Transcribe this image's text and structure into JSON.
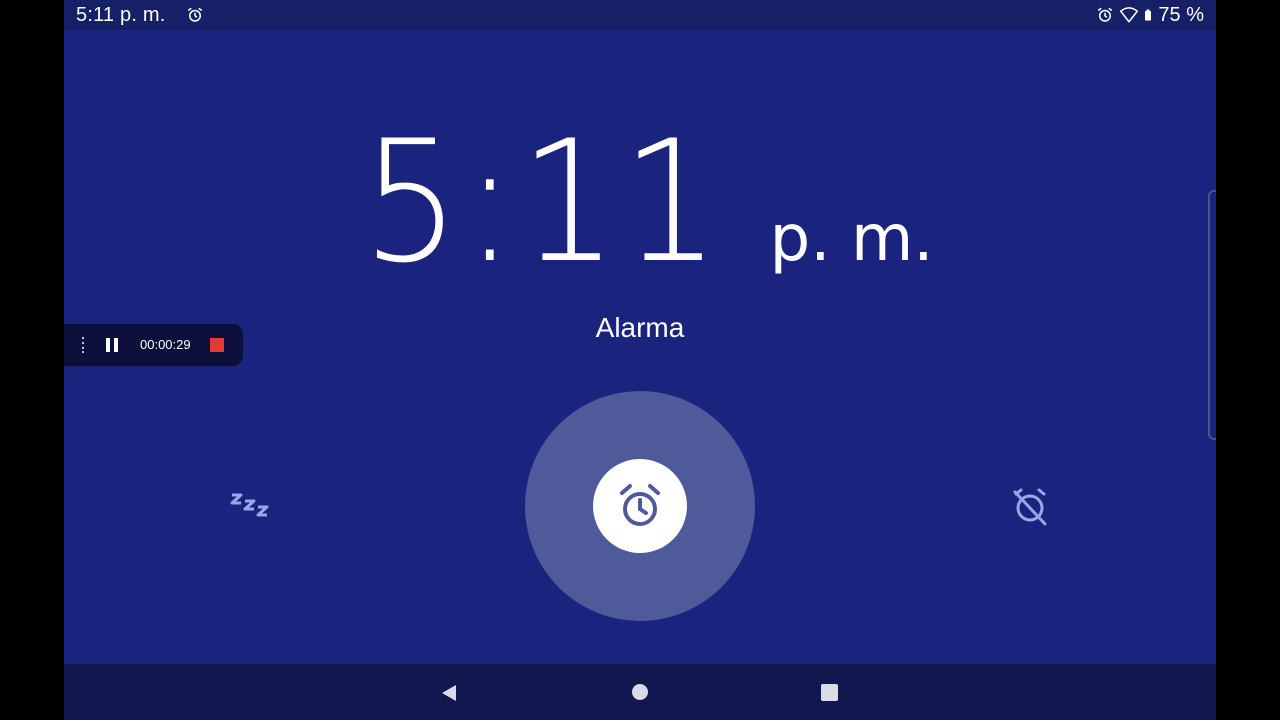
{
  "status_bar": {
    "time": "5:11 p. m.",
    "left_icons": [
      "alarm-icon"
    ],
    "right_icons": [
      "alarm-icon",
      "wifi-icon",
      "battery-icon"
    ],
    "battery_percent": "75 %"
  },
  "clock": {
    "time": "5:11",
    "ampm": "p. m."
  },
  "alarm": {
    "label": "Alarma",
    "actions": {
      "snooze_icon": "snooze-zzz-icon",
      "center_icon": "alarm-clock-icon",
      "dismiss_icon": "alarm-off-icon"
    }
  },
  "screen_recorder": {
    "elapsed": "00:00:29",
    "icons": [
      "drag-handle-icon",
      "pause-icon",
      "stop-icon"
    ]
  },
  "navigation_bar": {
    "icons": [
      "back-icon",
      "home-icon",
      "recents-icon"
    ]
  },
  "colors": {
    "background": "#1a237e",
    "halo": "#4e5a9a",
    "accent_icon": "#9aa6e8",
    "record_stop": "#e53935"
  }
}
